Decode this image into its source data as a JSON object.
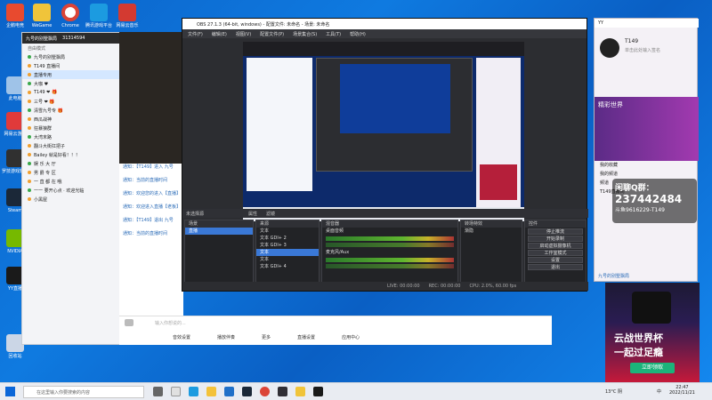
{
  "desktop": {
    "icons": [
      {
        "label": "企鹅电竞",
        "color": "#e84a2f"
      },
      {
        "label": "WeGame",
        "color": "#f0c43a"
      },
      {
        "label": "Chrome",
        "color": "#ffffff"
      },
      {
        "label": "腾讯游戏平台",
        "color": "#1c9be0"
      },
      {
        "label": "网易云音乐",
        "color": "#d33a31"
      },
      {
        "label": "此电脑",
        "color": "#9fc3e8"
      },
      {
        "label": "网易云游戏",
        "color": "#e03a3a"
      },
      {
        "label": "罗技游戏软件",
        "color": "#303030"
      },
      {
        "label": "Steam",
        "color": "#1b2838"
      },
      {
        "label": "NVIDIA",
        "color": "#76b900"
      },
      {
        "label": "YY直播",
        "color": "#1a1a1a"
      },
      {
        "label": "回收站",
        "color": "#cbd6e6"
      }
    ]
  },
  "yy_left": {
    "channel_title": "九号的别墅飘局",
    "channel_id": "31314594",
    "mode_label": "自由模式",
    "room_tree": [
      {
        "label": "九号的别墅飘局",
        "sel": false
      },
      {
        "label": "T149 直播间",
        "sel": false
      },
      {
        "label": "直播专用",
        "sel": true
      },
      {
        "label": "大咖 ♥",
        "sel": false
      },
      {
        "label": "T149 ❤ 🎁",
        "sel": false
      },
      {
        "label": "三号 ❤ 🎁",
        "sel": false
      },
      {
        "label": "清雪九号专 🎁",
        "sel": false
      },
      {
        "label": "西瓜战神",
        "sel": false
      },
      {
        "label": "狂暴狼群",
        "sel": false
      },
      {
        "label": "大湾末路",
        "sel": false
      },
      {
        "label": "翻斗大街扛把子",
        "sel": false
      },
      {
        "label": "Bailey 就是好看！！！",
        "sel": false
      },
      {
        "label": "娱 乐 大 厅",
        "sel": false
      },
      {
        "label": "男 爵 专 区",
        "sel": false
      },
      {
        "label": "一 直 都 在 哦",
        "sel": false
      },
      {
        "label": "一一 要开心点 · 欢迎光临",
        "sel": false
      },
      {
        "label": "小黑屋",
        "sel": false
      }
    ],
    "sub_notes": [
      "直播室 退出直播",
      "正在公演"
    ]
  },
  "chat": {
    "messages": [
      "通知：【T149】进入 九号",
      "通知：当前的直播时间",
      "通知：欢迎您的进入【直播】",
      "通知：欢迎进入直播【老板】",
      "通知：【T149】退出 九号",
      "通知：当前的直播时间"
    ],
    "input_placeholder": "输入你想说的...",
    "toolbar": [
      "音效设置",
      "播放伴奏",
      "更多",
      "直播设置",
      "应用中心"
    ]
  },
  "obs": {
    "window_title": "OBS 27.1.3 (64-bit, windows) - 配置文件: 未命名 - 场景: 未命名",
    "menu": [
      "文件(F)",
      "编辑(E)",
      "视图(V)",
      "配置文件(P)",
      "场景集合(S)",
      "工具(T)",
      "帮助(H)"
    ],
    "no_source_label": "未选择源",
    "props_button": "属性",
    "filters_button": "滤镜",
    "docks": {
      "scenes": {
        "title": "场景",
        "items": [
          "直播"
        ]
      },
      "sources": {
        "title": "来源",
        "items": [
          "文本",
          "文本 GDI+ 2",
          "文本 GDI+ 3",
          "文本",
          "文本",
          "文本 GDI+ 4"
        ]
      },
      "mixer": {
        "title": "混音器",
        "tracks": [
          "桌面音频",
          "麦克风/Aux"
        ]
      },
      "transitions": {
        "title": "转场特效",
        "value": "渐隐"
      },
      "controls": {
        "title": "控件",
        "buttons": [
          "停止推流",
          "开始录制",
          "启动虚拟摄像机",
          "工作室模式",
          "设置",
          "退出"
        ]
      }
    },
    "status": [
      "LIVE: 00:00:00",
      "REC: 00:00:00",
      "CPU: 2.0%, 60.00 fps"
    ]
  },
  "yy_right": {
    "header": "YY",
    "user_name": "T149",
    "user_sign": "单击此处输入签名",
    "banner": "精彩世界",
    "qq_group_label": "闲聊Q群：",
    "qq_group_number": "237442484",
    "douyu": "斗鱼9616229-T149",
    "sub": "九号的别墅飘局",
    "list": [
      "我的收藏",
      "我的频道",
      "频道",
      "T149直播间"
    ]
  },
  "ad": {
    "line1": "云战世界杯",
    "line2": "一起过足瘾",
    "button": "立即领取"
  },
  "taskbar": {
    "search_placeholder": "在这里输入你要搜索的内容",
    "weather": "13°C 阴",
    "ime": "中",
    "time": "22:47",
    "date": "2022/11/21"
  },
  "colors": {
    "accent": "#0f7ae0",
    "obs_bg": "#2c2d31",
    "live_red": "#c5193a"
  }
}
